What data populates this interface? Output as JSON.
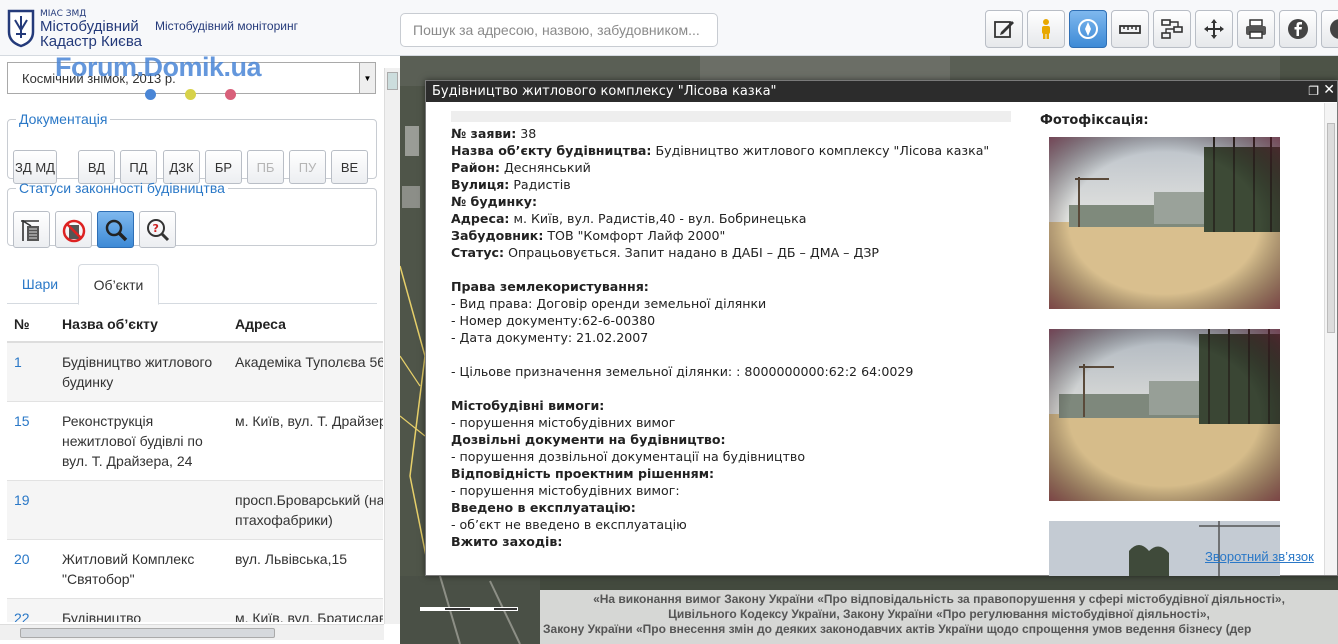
{
  "header": {
    "logo_small": "МІАС ЗМД",
    "logo_line1": "Містобудівний",
    "logo_line2": "Кадастр Києва",
    "subtitle": "Містобудівний моніторинг",
    "search_placeholder": "Пошук за адресою, назвою, забудовником...",
    "tools": [
      "edit-icon",
      "person-icon",
      "compass-icon",
      "ruler-icon",
      "scheme-icon",
      "move-icon",
      "print-icon",
      "facebook-icon",
      "help-icon"
    ]
  },
  "watermark": "Forum.Domik.ua",
  "left_panel": {
    "layer_select": "Космічний знімок, 2013 р.",
    "documents": {
      "legend": "Документація",
      "buttons": [
        "ЗД МД",
        "ВД",
        "ПД",
        "ДЗК",
        "БР",
        "ПБ",
        "ПУ",
        "ВЕ"
      ]
    },
    "statuses": {
      "legend": "Статуси законності будівництва",
      "buttons": [
        "building-crane-icon",
        "no-building-icon",
        "search-icon",
        "question-search-icon"
      ]
    },
    "tabs": [
      "Шари",
      "Об’єкти"
    ],
    "table": {
      "headers": [
        "№",
        "Назва об’єкту",
        "Адреса"
      ],
      "rows": [
        {
          "num": "1",
          "name": "Будівництво житлового будинку",
          "address": "Академіка Туполєва 56"
        },
        {
          "num": "15",
          "name": "Реконструкція нежитлової будівлі по вул. Т. Драйзера, 24",
          "address": "м. Київ, вул. Т. Драйзера"
        },
        {
          "num": "19",
          "name": "",
          "address": "просп.Броварський (на птахофабрики)"
        },
        {
          "num": "20",
          "name": "Житловий Комплекс \"Святобор\"",
          "address": "вул. Львівська,15"
        },
        {
          "num": "22",
          "name": "Будівництво",
          "address": "м. Київ, вул. Братислав"
        }
      ]
    }
  },
  "popup": {
    "title": "Будівництво житлового комплексу \"Лісова казка\"",
    "fields": [
      {
        "label": "№ заяви:",
        "value": " 38"
      },
      {
        "label": "Назва об’єкту будівництва:",
        "value": " Будівництво житлового комплексу \"Лісова казка\""
      },
      {
        "label": "Район:",
        "value": " Деснянський"
      },
      {
        "label": "Вулиця:",
        "value": " Радистів"
      },
      {
        "label": "№ будинку:",
        "value": ""
      },
      {
        "label": "Адреса:",
        "value": " м. Київ, вул. Радистів,40 - вул. Бобринецька"
      },
      {
        "label": "Забудовник:",
        "value": " ТОВ \"Комфорт Лайф 2000\""
      },
      {
        "label": "Статус:",
        "value": " Опрацьовується. Запит надано в ДАБІ – ДБ – ДМА – ДЗР"
      }
    ],
    "land": {
      "heading": "Права землекористування:",
      "lines": [
        "- Вид права: Договір оренди земельної ділянки",
        "- Номер документу:62-6-00380",
        "- Дата документу:  21.02.2007"
      ],
      "purpose": "- Цільове призначення земельної ділянки: : 8000000000:62:2 64:0029"
    },
    "requirements": [
      {
        "heading": "Містобудівні вимоги:",
        "value": "- порушення містобудівних вимог"
      },
      {
        "heading": "Дозвільні документи на будівництво:",
        "value": "- порушення дозвільної документації на будівництво"
      },
      {
        "heading": "Відповідність проектним рішенням:",
        "value": "- порушення містобудівних вимог:"
      },
      {
        "heading": "Введено в експлуатацію:",
        "value": "- об’єкт не введено в експлуатацію"
      },
      {
        "heading": "Вжито заходів:",
        "value": ""
      }
    ],
    "photo_title": "Фотофіксація:",
    "feedback": "Зворотний зв’язок"
  },
  "map": {
    "bottom_text": [
      "«На виконання вимог Закону України «Про відповідальність за правопорушення у сфері містобудівної діяльності»,",
      "Цивільного Кодексу України, Закону України «Про регулювання містобудівної діяльності»,",
      "Закону України «Про внесення змін до деяких законодавчих актів України щодо спрощення умов ведення бізнесу (дер"
    ]
  },
  "colors": {
    "accent": "#2a78c7",
    "active_button": "#3d8ad6",
    "popup_title_bg": "#2c2c2c"
  }
}
